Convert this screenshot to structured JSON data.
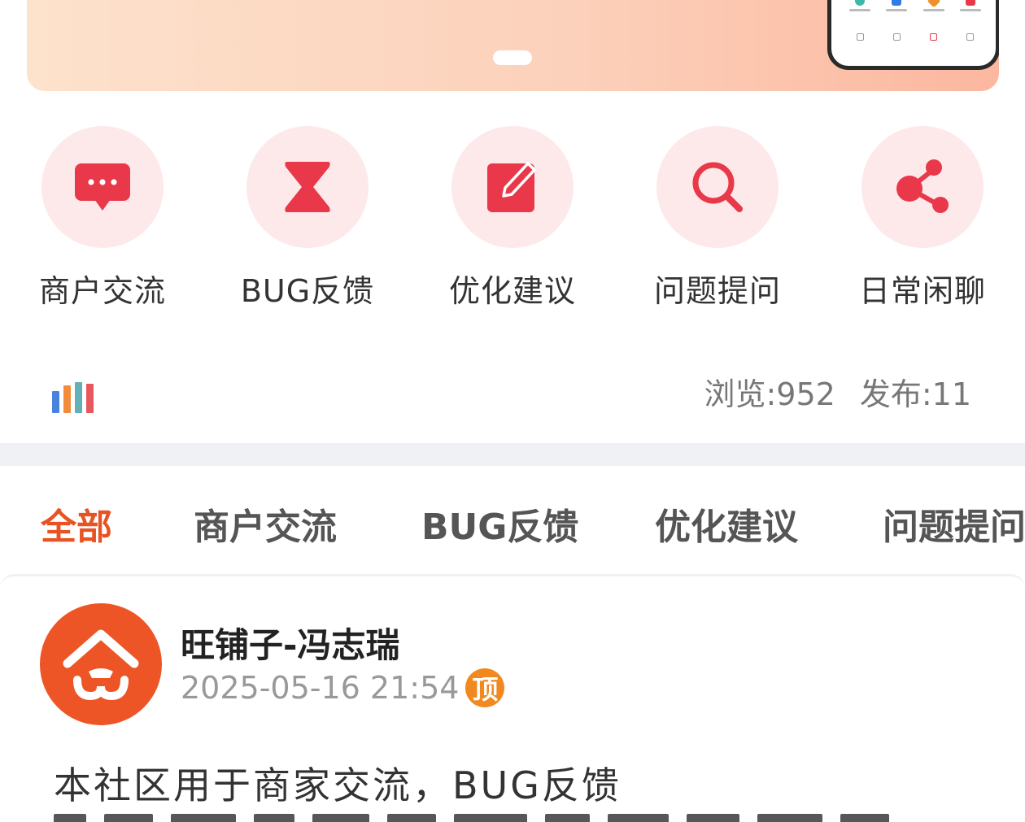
{
  "banner": {
    "page_indicator": "1"
  },
  "categories": [
    {
      "label": "商户交流",
      "icon": "chat-bubble-icon"
    },
    {
      "label": "BUG反馈",
      "icon": "hourglass-icon"
    },
    {
      "label": "优化建议",
      "icon": "edit-icon"
    },
    {
      "label": "问题提问",
      "icon": "search-icon"
    },
    {
      "label": "日常闲聊",
      "icon": "share-icon"
    }
  ],
  "stats": {
    "views_label": "浏览:",
    "views_value": "952",
    "posts_label": "发布:",
    "posts_value": "11"
  },
  "tabs": [
    {
      "label": "全部",
      "active": true
    },
    {
      "label": "商户交流",
      "active": false
    },
    {
      "label": "BUG反馈",
      "active": false
    },
    {
      "label": "优化建议",
      "active": false
    },
    {
      "label": "问题提问",
      "active": false
    }
  ],
  "post": {
    "author": "旺铺子-冯志瑞",
    "time": "2025-05-16 21:54",
    "badge": "顶",
    "content": "本社区用于商家交流，BUG反馈"
  },
  "colors": {
    "accent": "#e85324",
    "icon_red": "#e8384a",
    "icon_bg": "#fde9ea",
    "badge_orange": "#f2891f",
    "avatar_orange": "#ee5526"
  }
}
